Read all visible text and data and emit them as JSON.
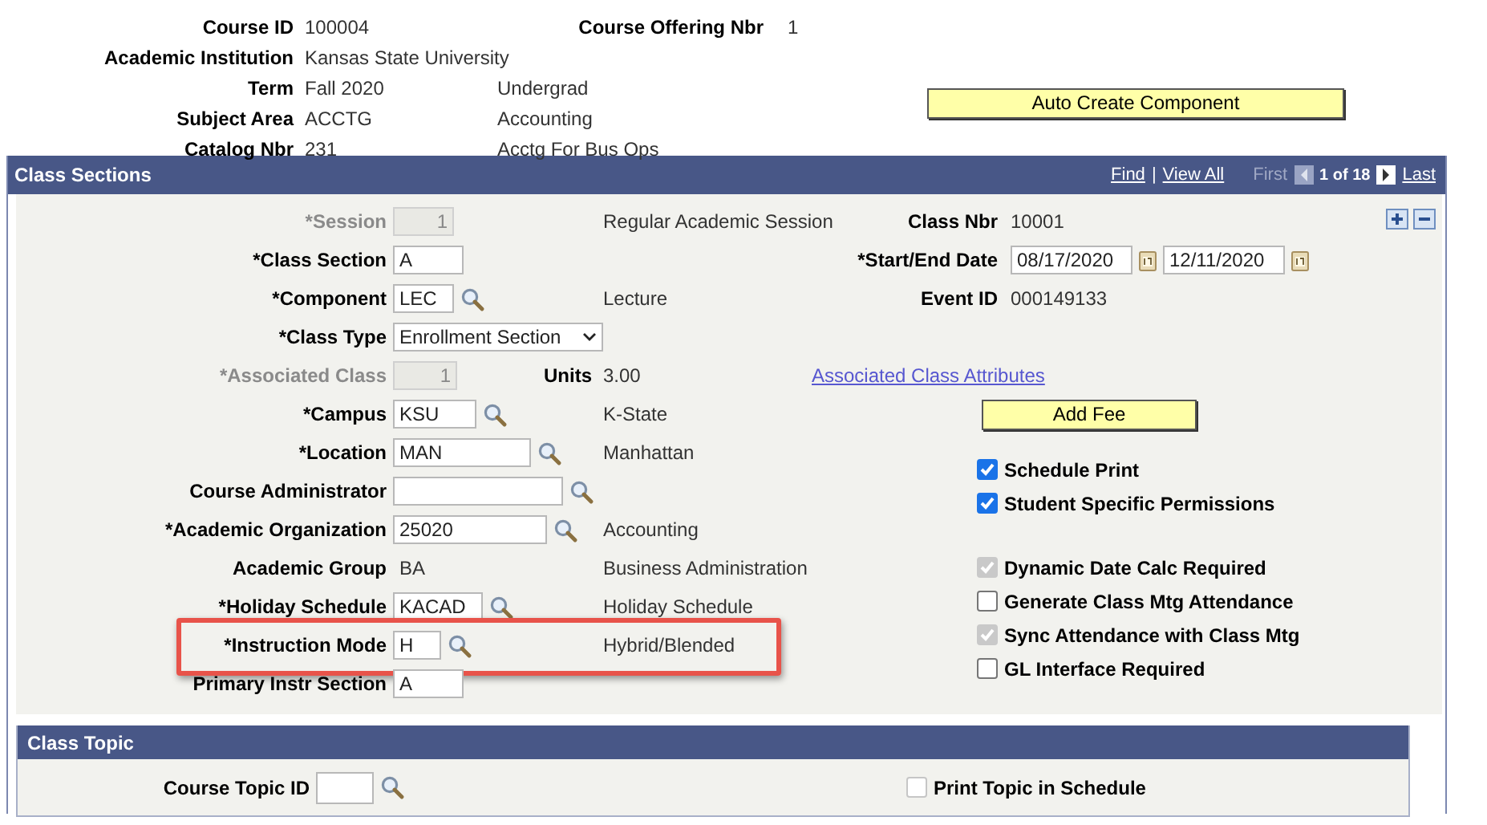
{
  "course": {
    "fields": [
      {
        "label": "Course ID",
        "value": "100004"
      },
      {
        "label": "Academic Institution",
        "value": "Kansas State University"
      },
      {
        "label": "Term",
        "value": "Fall 2020",
        "description": "Undergrad"
      },
      {
        "label": "Subject Area",
        "value": "ACCTG",
        "description": "Accounting"
      },
      {
        "label": "Catalog Nbr",
        "value": "231",
        "description": "Acctg For Bus Ops"
      }
    ],
    "offering": {
      "label": "Course Offering Nbr",
      "value": "1"
    },
    "auto_create_button": "Auto Create Component"
  },
  "class_sections": {
    "title": "Class Sections",
    "find": "Find",
    "separator": "|",
    "view_all": "View All",
    "first": "First",
    "count": "1 of 18",
    "last": "Last",
    "fields": [
      {
        "kind": "input",
        "label": "*Session",
        "value": "1",
        "disabled": true,
        "highlighted": false,
        "description": "Regular Academic Session"
      },
      {
        "kind": "input",
        "label": "*Class Section",
        "value": "A",
        "disabled": false,
        "highlighted": false
      },
      {
        "kind": "lookup",
        "label": "*Component",
        "value": "LEC",
        "disabled": false,
        "highlighted": false,
        "description": "Lecture"
      },
      {
        "kind": "select",
        "label": "*Class Type",
        "value": "Enrollment Section",
        "disabled": false,
        "highlighted": false
      },
      {
        "kind": "input",
        "label": "*Associated Class",
        "value": "1",
        "disabled": true,
        "highlighted": false,
        "extra": {
          "label": "Units",
          "value": "3.00"
        }
      },
      {
        "kind": "lookup",
        "label": "*Campus",
        "value": "KSU",
        "disabled": false,
        "highlighted": false,
        "description": "K-State"
      },
      {
        "kind": "lookup",
        "label": "*Location",
        "value": "MAN",
        "disabled": false,
        "highlighted": false,
        "description": "Manhattan"
      },
      {
        "kind": "lookup",
        "label": "Course Administrator",
        "disabled": false,
        "highlighted": false
      },
      {
        "kind": "lookup",
        "label": "*Academic Organization",
        "value": "25020",
        "disabled": false,
        "highlighted": false,
        "description": "Accounting"
      },
      {
        "kind": "text",
        "label": "Academic Group",
        "value": "BA",
        "disabled": false,
        "highlighted": false,
        "description": "Business Administration"
      },
      {
        "kind": "lookup",
        "label": "*Holiday Schedule",
        "value": "KACAD",
        "disabled": false,
        "highlighted": false,
        "description": "Holiday Schedule"
      },
      {
        "kind": "lookup",
        "label": "*Instruction Mode",
        "value": "H",
        "disabled": false,
        "highlighted": true,
        "description": "Hybrid/Blended"
      },
      {
        "kind": "input",
        "label": "Primary Instr Section",
        "value": "A",
        "disabled": false,
        "highlighted": false
      }
    ],
    "class_nbr": {
      "label": "Class Nbr",
      "value": "10001"
    },
    "dates": {
      "label": "*Start/End Date",
      "start": "08/17/2020",
      "end": "12/11/2020"
    },
    "event_id": {
      "label": "Event ID",
      "value": "000149133"
    },
    "attributes_link": "Associated Class Attributes",
    "add_fee_button": "Add Fee",
    "checkbox_groups": [
      [
        {
          "label": "Schedule Print",
          "checked": true,
          "disabled": false
        },
        {
          "label": "Student Specific Permissions",
          "checked": true,
          "disabled": false
        }
      ],
      [
        {
          "label": "Dynamic Date Calc Required",
          "checked": true,
          "disabled": true
        },
        {
          "label": "Generate Class Mtg Attendance",
          "checked": false,
          "disabled": false
        },
        {
          "label": "Sync Attendance with Class Mtg",
          "checked": true,
          "disabled": true
        },
        {
          "label": "GL Interface Required",
          "checked": false,
          "disabled": false
        }
      ]
    ]
  },
  "class_topic": {
    "title": "Class Topic",
    "field_label": "Course Topic ID",
    "checkbox": {
      "label": "Print Topic in Schedule",
      "checked": false,
      "disabled": true
    }
  }
}
